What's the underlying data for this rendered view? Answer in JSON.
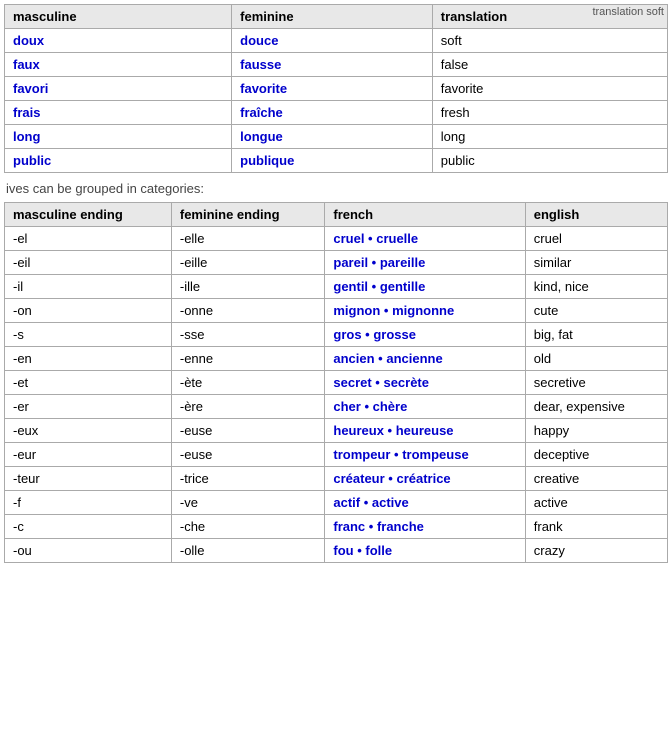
{
  "topHint": "translation soft",
  "table1": {
    "headers": [
      "masculine",
      "feminine",
      "translation"
    ],
    "rows": [
      [
        "doux",
        "douce",
        "soft"
      ],
      [
        "faux",
        "fausse",
        "false"
      ],
      [
        "favori",
        "favorite",
        "favorite"
      ],
      [
        "frais",
        "fraîche",
        "fresh"
      ],
      [
        "long",
        "longue",
        "long"
      ],
      [
        "public",
        "publique",
        "public"
      ]
    ]
  },
  "middleText": "ives can be grouped in categories:",
  "table2": {
    "headers": [
      "masculine ending",
      "feminine ending",
      "french",
      "english"
    ],
    "rows": [
      [
        "-el",
        "-elle",
        "cruel • cruelle",
        "cruel"
      ],
      [
        "-eil",
        "-eille",
        "pareil • pareille",
        "similar"
      ],
      [
        "-il",
        "-ille",
        "gentil • gentille",
        "kind, nice"
      ],
      [
        "-on",
        "-onne",
        "mignon • mignonne",
        "cute"
      ],
      [
        "-s",
        "-sse",
        "gros • grosse",
        "big, fat"
      ],
      [
        "-en",
        "-enne",
        "ancien • ancienne",
        "old"
      ],
      [
        "-et",
        "-ète",
        "secret • secrète",
        "secretive"
      ],
      [
        "-er",
        "-ère",
        "cher • chère",
        "dear, expensive"
      ],
      [
        "-eux",
        "-euse",
        "heureux • heureuse",
        "happy"
      ],
      [
        "-eur",
        "-euse",
        "trompeur • trompeuse",
        "deceptive"
      ],
      [
        "-teur",
        "-trice",
        "créateur • créatrice",
        "creative"
      ],
      [
        "-f",
        "-ve",
        "actif • active",
        "active"
      ],
      [
        "-c",
        "-che",
        "franc • franche",
        "frank"
      ],
      [
        "-ou",
        "-olle",
        "fou • folle",
        "crazy"
      ]
    ]
  }
}
